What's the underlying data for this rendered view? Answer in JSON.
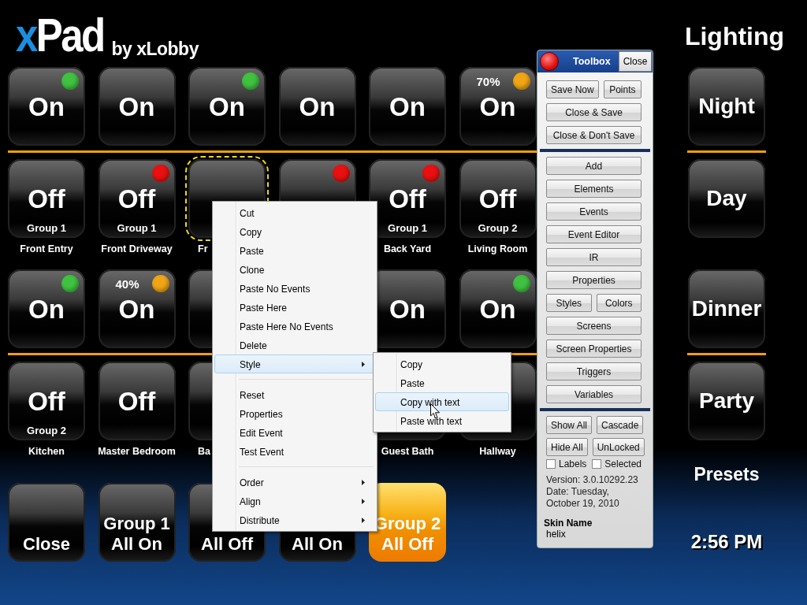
{
  "logo": {
    "text": "xPad",
    "byline": "by xLobby"
  },
  "grid_rows": [
    {
      "tiles": [
        {
          "text": "On",
          "color": "#3fc23f",
          "selected": false
        },
        {
          "text": "On",
          "selected": false
        },
        {
          "text": "On",
          "color": "#3fc23f",
          "selected": false
        },
        {
          "text": "On",
          "selected": false
        },
        {
          "text": "On",
          "selected": false
        },
        {
          "text": "On",
          "level_text": "70%",
          "color": "#f0a515",
          "selected": false
        }
      ]
    },
    {
      "tiles": [
        {
          "text": "Off",
          "group": "Group 1",
          "room": "Front Entry",
          "selected": false
        },
        {
          "text": "Off",
          "color": "#e81010",
          "group": "Group 1",
          "room": "Front Driveway",
          "selected": false
        },
        {
          "room": "Fr",
          "selected": true
        },
        {
          "color": "#e81010",
          "selected": false
        },
        {
          "text": "Off",
          "color": "#e81010",
          "group": "Group 1",
          "room": "Back Yard",
          "selected": false
        },
        {
          "text": "Off",
          "group": "Group 2",
          "room": "Living Room",
          "selected": false
        }
      ]
    },
    {
      "tiles": [
        {
          "text": "On",
          "color": "#3fc23f",
          "selected": false
        },
        {
          "text": "On",
          "level_text": "40%",
          "color": "#f0a515",
          "selected": false
        },
        {
          "selected": false
        }
      ],
      "tiles_after_gap": [
        {
          "text": "On",
          "selected": false
        },
        {
          "text": "On",
          "color": "#3fc23f",
          "selected": false
        }
      ]
    },
    {
      "tiles": [
        {
          "text": "Off",
          "group": "Group 2",
          "room": "Kitchen",
          "selected": false
        },
        {
          "text": "Off",
          "room": "Master Bedroom",
          "selected": false
        },
        {
          "room": "Ba",
          "selected": false
        }
      ],
      "tiles_after_gap": [
        {
          "room": "Guest Bath",
          "selected": false
        },
        {
          "room": "Hallway",
          "selected": false
        }
      ]
    }
  ],
  "bottom_buttons": [
    {
      "lines": [
        "Close"
      ],
      "highlighted": false
    },
    {
      "lines": [
        "Group 1",
        "All On"
      ],
      "highlighted": false
    },
    {
      "lines": [
        "All Off"
      ],
      "highlighted": false
    },
    {
      "lines": [
        "All On"
      ],
      "highlighted": false
    },
    {
      "lines": [
        "Group 2",
        "All Off"
      ],
      "highlighted": true
    }
  ],
  "panel_title": "Lighting",
  "scenes": [
    {
      "label": "Night"
    },
    {
      "label": "Day"
    },
    {
      "label": "Dinner"
    },
    {
      "label": "Party"
    }
  ],
  "presets_label": "Presets",
  "time": "2:56 PM",
  "toolbox": {
    "title": "Toolbox",
    "close": "Close",
    "sections": [
      [
        [
          "Save Now",
          "Points"
        ],
        [
          "Close & Save"
        ],
        [
          "Close & Don't Save"
        ]
      ],
      [
        [
          "Add"
        ],
        [
          "Elements"
        ],
        [
          "Events"
        ],
        [
          "Event Editor"
        ],
        [
          "IR"
        ],
        [
          "Properties"
        ],
        [
          "Styles",
          "Colors"
        ],
        [
          "Screens"
        ],
        [
          "Screen Properties"
        ],
        [
          "Triggers"
        ],
        [
          "Variables"
        ]
      ],
      [
        [
          "Show All",
          "Cascade"
        ],
        [
          "Hide All",
          "UnLocked"
        ]
      ]
    ],
    "checkboxes": [
      {
        "label": "Labels",
        "checked": false
      },
      {
        "label": "Selected",
        "checked": false
      }
    ],
    "version": "Version: 3.0.10292.23",
    "date": "Date: Tuesday, October 19, 2010",
    "skin_name_label": "Skin Name",
    "skin_name": "helix"
  },
  "context_menu": {
    "items": [
      {
        "kind": "item",
        "label": "Cut",
        "submenu": false,
        "selected": false
      },
      {
        "kind": "item",
        "label": "Copy",
        "submenu": false,
        "selected": false
      },
      {
        "kind": "item",
        "label": "Paste",
        "submenu": false,
        "selected": false
      },
      {
        "kind": "item",
        "label": "Clone",
        "submenu": false,
        "selected": false
      },
      {
        "kind": "item",
        "label": "Paste No Events",
        "submenu": false,
        "selected": false
      },
      {
        "kind": "item",
        "label": "Paste Here",
        "submenu": false,
        "selected": false
      },
      {
        "kind": "item",
        "label": "Paste Here No Events",
        "submenu": false,
        "selected": false
      },
      {
        "kind": "item",
        "label": "Delete",
        "submenu": false,
        "selected": false
      },
      {
        "kind": "item",
        "label": "Style",
        "submenu": true,
        "selected": true
      },
      {
        "kind": "separator"
      },
      {
        "kind": "item",
        "label": "Reset",
        "submenu": false,
        "selected": false
      },
      {
        "kind": "item",
        "label": "Properties",
        "submenu": false,
        "selected": false
      },
      {
        "kind": "item",
        "label": "Edit Event",
        "submenu": false,
        "selected": false
      },
      {
        "kind": "item",
        "label": "Test Event",
        "submenu": false,
        "selected": false
      },
      {
        "kind": "separator"
      },
      {
        "kind": "item",
        "label": "Order",
        "submenu": true,
        "selected": false
      },
      {
        "kind": "item",
        "label": "Align",
        "submenu": true,
        "selected": false
      },
      {
        "kind": "item",
        "label": "Distribute",
        "submenu": true,
        "selected": false
      }
    ],
    "submenu": [
      {
        "label": "Copy",
        "selected": false
      },
      {
        "label": "Paste",
        "selected": false
      },
      {
        "label": "Copy with text",
        "selected": true
      },
      {
        "label": "Paste with text",
        "selected": false
      }
    ]
  }
}
